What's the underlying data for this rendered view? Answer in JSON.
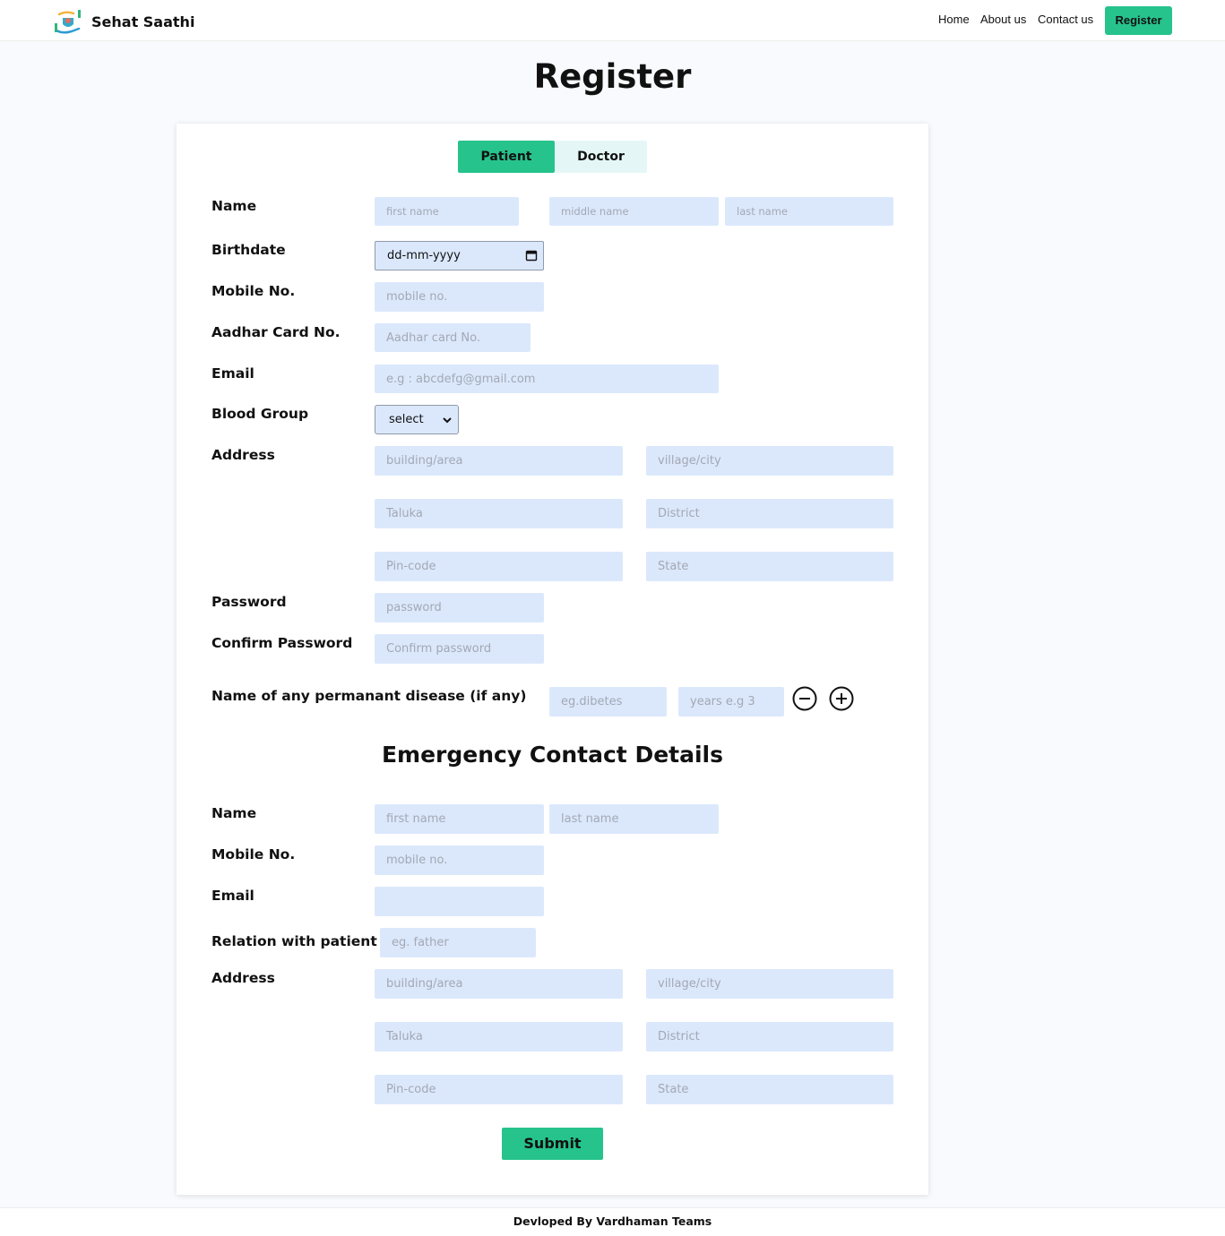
{
  "brand": {
    "name": "Sehat Saathi",
    "logo_icon": "hands-health-logo-icon"
  },
  "nav": {
    "home": "Home",
    "about": "About us",
    "contact": "Contact us",
    "register": "Register"
  },
  "page_title": "Register",
  "tabs": {
    "patient": "Patient",
    "doctor": "Doctor",
    "active": "Patient"
  },
  "colors": {
    "accent": "#26c38d",
    "field_bg": "#dbe8fc",
    "tab_inactive_bg": "#e4f7f6"
  },
  "patient": {
    "labels": {
      "name": "Name",
      "birthdate": "Birthdate",
      "mobile": "Mobile No.",
      "aadhar": "Aadhar Card No.",
      "email": "Email",
      "blood_group": "Blood Group",
      "address": "Address",
      "password": "Password",
      "confirm_password": "Confirm Password",
      "disease": "Name of any permanant disease (if any)"
    },
    "placeholders": {
      "first_name": "first name",
      "middle_name": "middle name",
      "last_name": "last name",
      "mobile": "mobile no.",
      "aadhar": "Aadhar card No.",
      "email": "e.g : abcdefg@gmail.com",
      "building": "building/area",
      "village": "village/city",
      "taluka": "Taluka",
      "district": "District",
      "pincode": "Pin-code",
      "state": "State",
      "password": "password",
      "confirm_password": "Confirm password",
      "disease": "eg.dibetes",
      "years": "years e.g 3"
    },
    "birthdate_value": "dd-mm-yyyy",
    "blood_group_value": "select"
  },
  "emergency": {
    "title": "Emergency Contact Details",
    "labels": {
      "name": "Name",
      "mobile": "Mobile No.",
      "email": "Email",
      "relation": "Relation with patient",
      "address": "Address"
    },
    "placeholders": {
      "first_name": "first name",
      "last_name": "last name",
      "mobile": "mobile no.",
      "email": "",
      "relation": "eg. father",
      "building": "building/area",
      "village": "village/city",
      "taluka": "Taluka",
      "district": "District",
      "pincode": "Pin-code",
      "state": "State"
    }
  },
  "submit_label": "Submit",
  "footer": "Devloped By Vardhaman Teams"
}
